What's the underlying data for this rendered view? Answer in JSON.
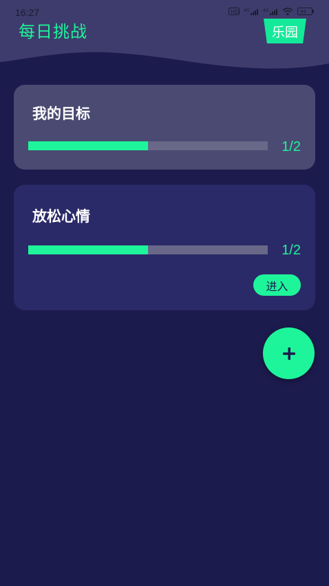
{
  "status_bar": {
    "time": "16:27",
    "battery": "99"
  },
  "header": {
    "title": "每日挑战",
    "park_button": "乐园"
  },
  "cards": [
    {
      "title": "我的目标",
      "progress": 0.5,
      "count_label": "1/2"
    },
    {
      "title": "放松心情",
      "progress": 0.5,
      "count_label": "1/2",
      "enter_button": "进入"
    }
  ],
  "fab": {
    "icon": "plus-icon"
  },
  "colors": {
    "accent": "#1ef59a",
    "background": "#1c1b4d",
    "card_highlight": "#4a4a72",
    "card": "#2b2a68"
  }
}
